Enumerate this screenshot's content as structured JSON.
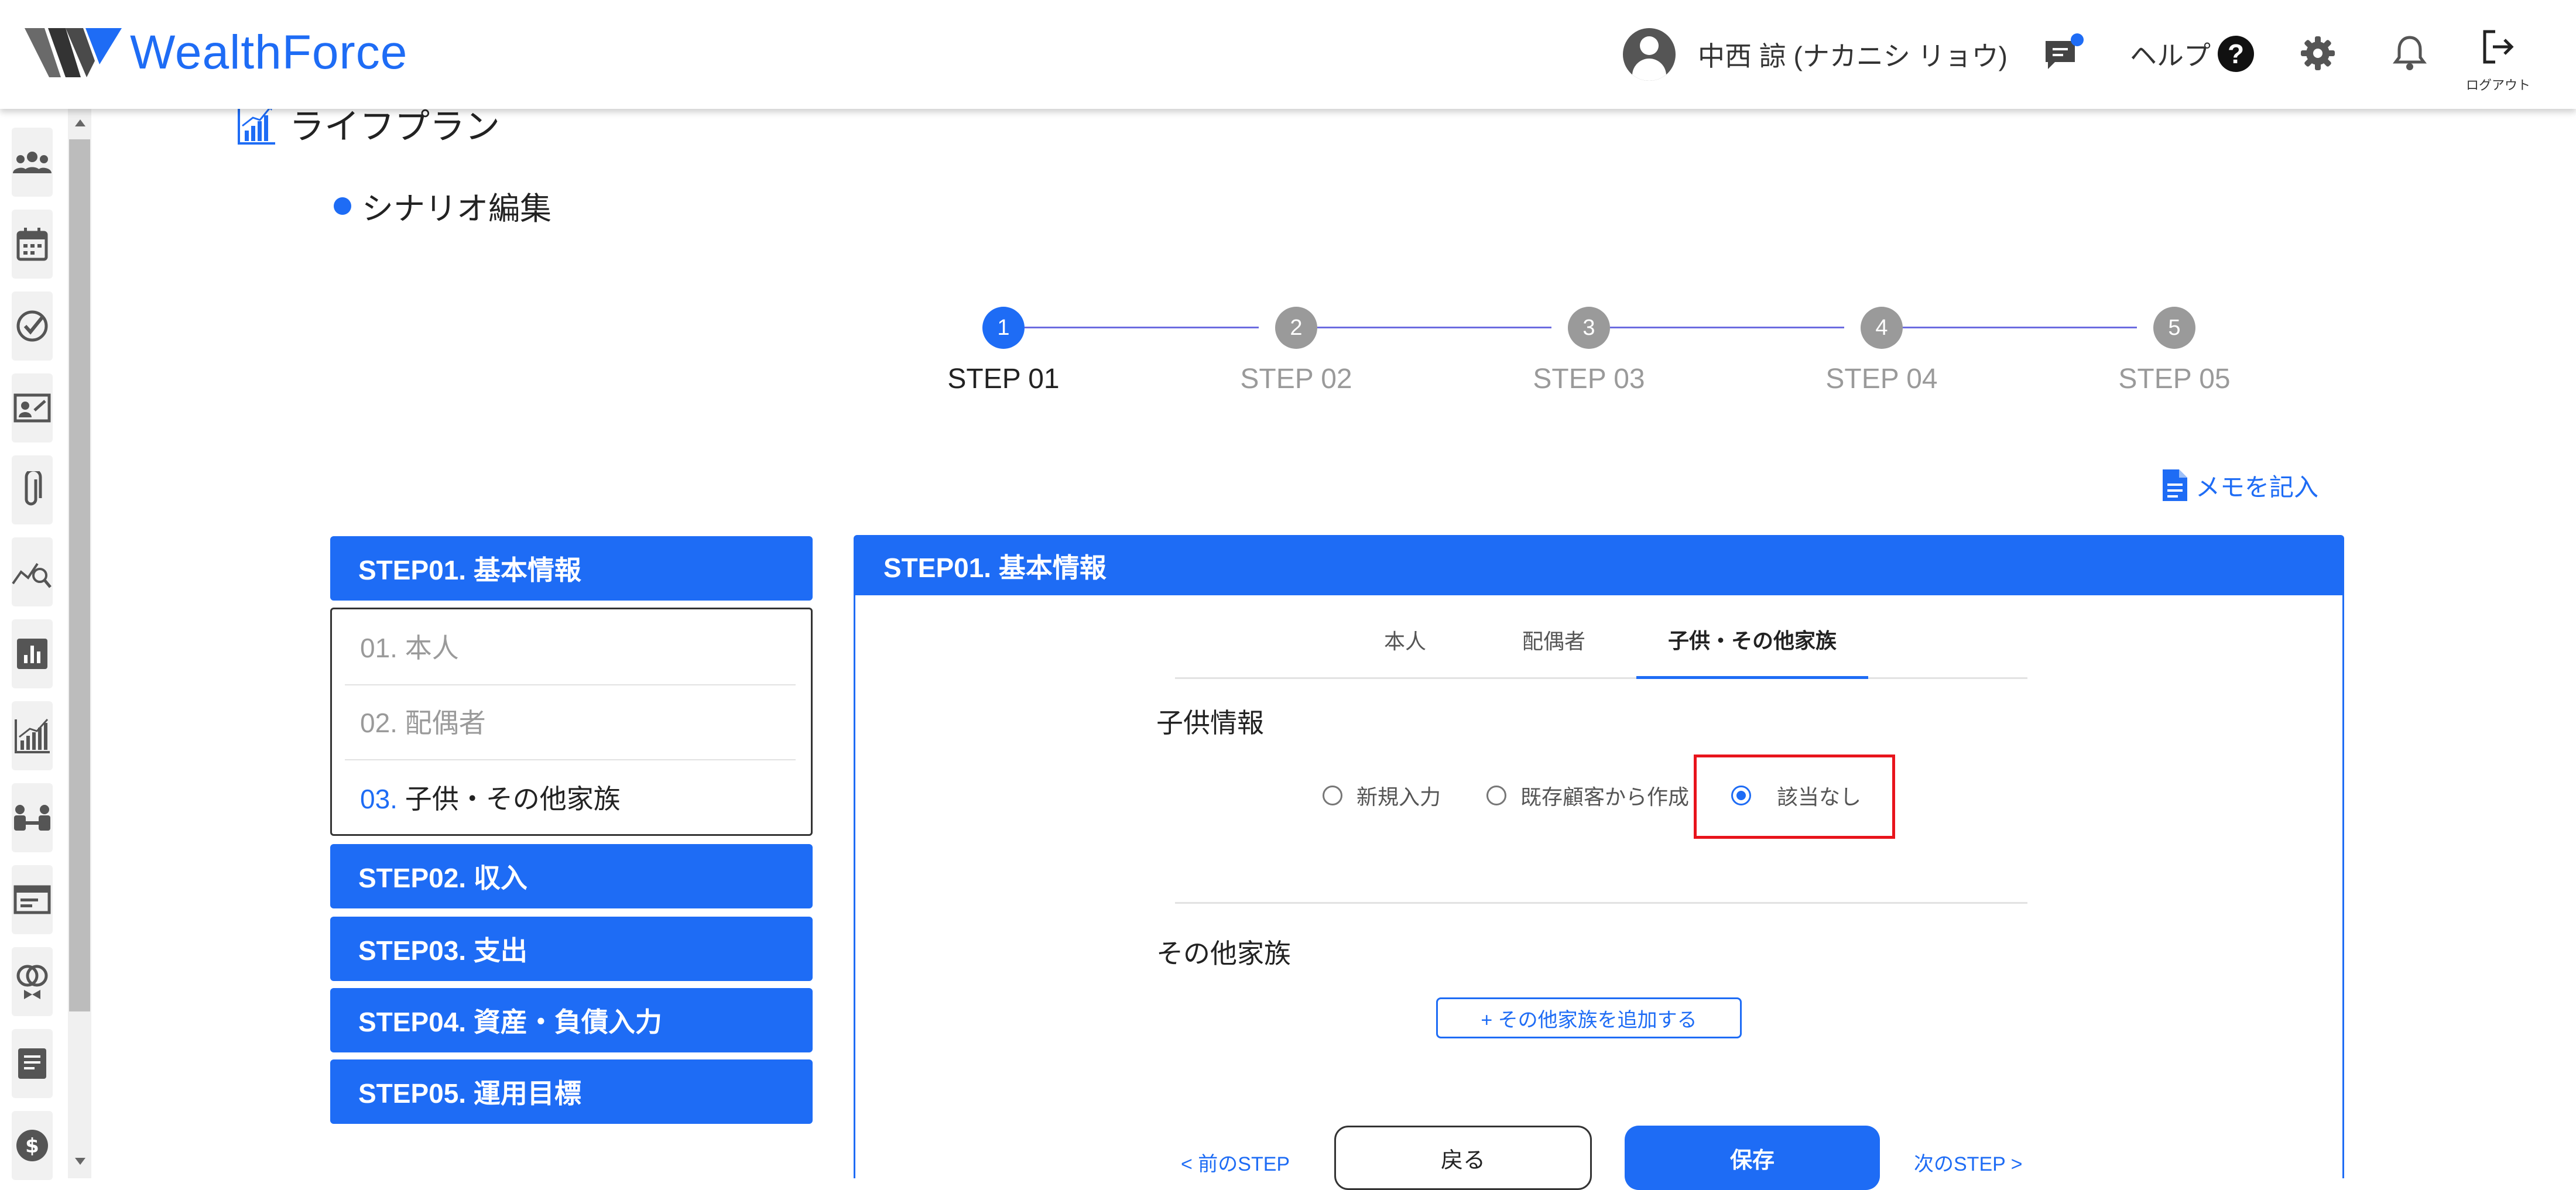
{
  "header": {
    "brand": "WealthForce",
    "user_name": "中西 諒 (ナカニシ リョウ)",
    "help_label": "ヘルプ",
    "help_icon_glyph": "?",
    "logout_label": "ログアウト",
    "icons": [
      "account-circle-icon",
      "chat-icon",
      "help-icon",
      "gear-icon",
      "bell-icon",
      "logout-icon"
    ]
  },
  "sidebar": {
    "icons": [
      "people-icon",
      "calendar-icon",
      "check-circle-icon",
      "id-card-icon",
      "paperclip-icon",
      "analysis-icon",
      "bar-chart-icon",
      "growth-chart-icon",
      "meeting-icon",
      "card-icon",
      "rings-icon",
      "document-icon",
      "dollar-icon"
    ]
  },
  "page": {
    "title": "ライフプラン",
    "subtitle": "シナリオ編集"
  },
  "stepper": {
    "steps": [
      {
        "num": "1",
        "label": "STEP 01",
        "active": true
      },
      {
        "num": "2",
        "label": "STEP 02",
        "active": false
      },
      {
        "num": "3",
        "label": "STEP 03",
        "active": false
      },
      {
        "num": "4",
        "label": "STEP 04",
        "active": false
      },
      {
        "num": "5",
        "label": "STEP 05",
        "active": false
      }
    ]
  },
  "memo_link": "メモを記入",
  "left_nav": {
    "step1": "STEP01. 基本情報",
    "sub_items": [
      {
        "num": "01.",
        "label": "本人"
      },
      {
        "num": "02.",
        "label": "配偶者"
      },
      {
        "num": "03.",
        "label": "子供・その他家族"
      }
    ],
    "step2": "STEP02. 収入",
    "step3": "STEP03. 支出",
    "step4": "STEP04. 資産・負債入力",
    "step5": "STEP05. 運用目標"
  },
  "main": {
    "header": "STEP01. 基本情報",
    "tabs": [
      "本人",
      "配偶者",
      "子供・その他家族"
    ],
    "active_tab": "子供・その他家族",
    "children_title": "子供情報",
    "radio_options": [
      "新規入力",
      "既存顧客から作成",
      "該当なし"
    ],
    "selected_radio": "該当なし",
    "others_title": "その他家族",
    "add_family_button": "+ その他家族を追加する",
    "prev_link": "< 前のSTEP",
    "back_button": "戻る",
    "save_button": "保存",
    "next_link": "次のSTEP >"
  },
  "colors": {
    "accent": "#1e6cf5",
    "highlight": "#e8141c",
    "inactive_step": "#9a9a9a"
  }
}
